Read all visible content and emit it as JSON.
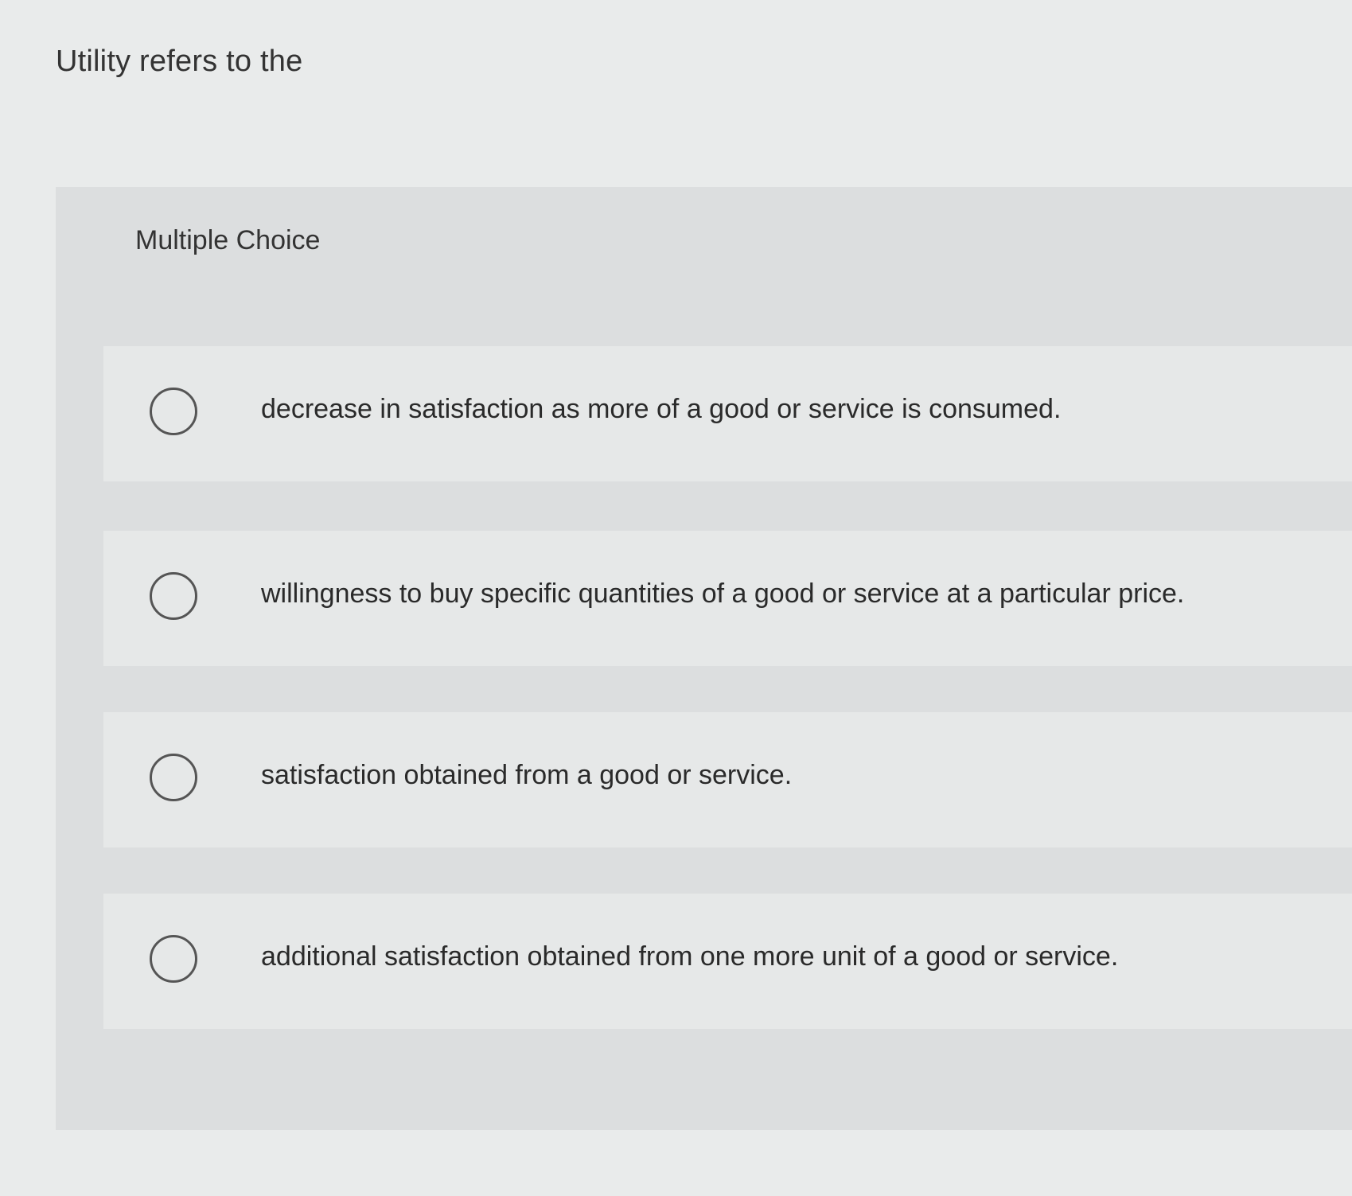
{
  "question": {
    "text": "Utility refers to the"
  },
  "multiple_choice": {
    "heading": "Multiple Choice",
    "options": [
      {
        "label": "decrease in satisfaction as more of a good or service is consumed.",
        "selected": false
      },
      {
        "label": "willingness to buy specific quantities of a good or service at a particular price.",
        "selected": false
      },
      {
        "label": "satisfaction obtained from a good or service.",
        "selected": false
      },
      {
        "label": "additional satisfaction obtained from one more unit of a good or service.",
        "selected": false
      }
    ]
  },
  "colors": {
    "page_background": "#e9ebeb",
    "panel_background": "#dcdedf",
    "option_background": "#e6e8e8",
    "radio_border": "#555555"
  }
}
